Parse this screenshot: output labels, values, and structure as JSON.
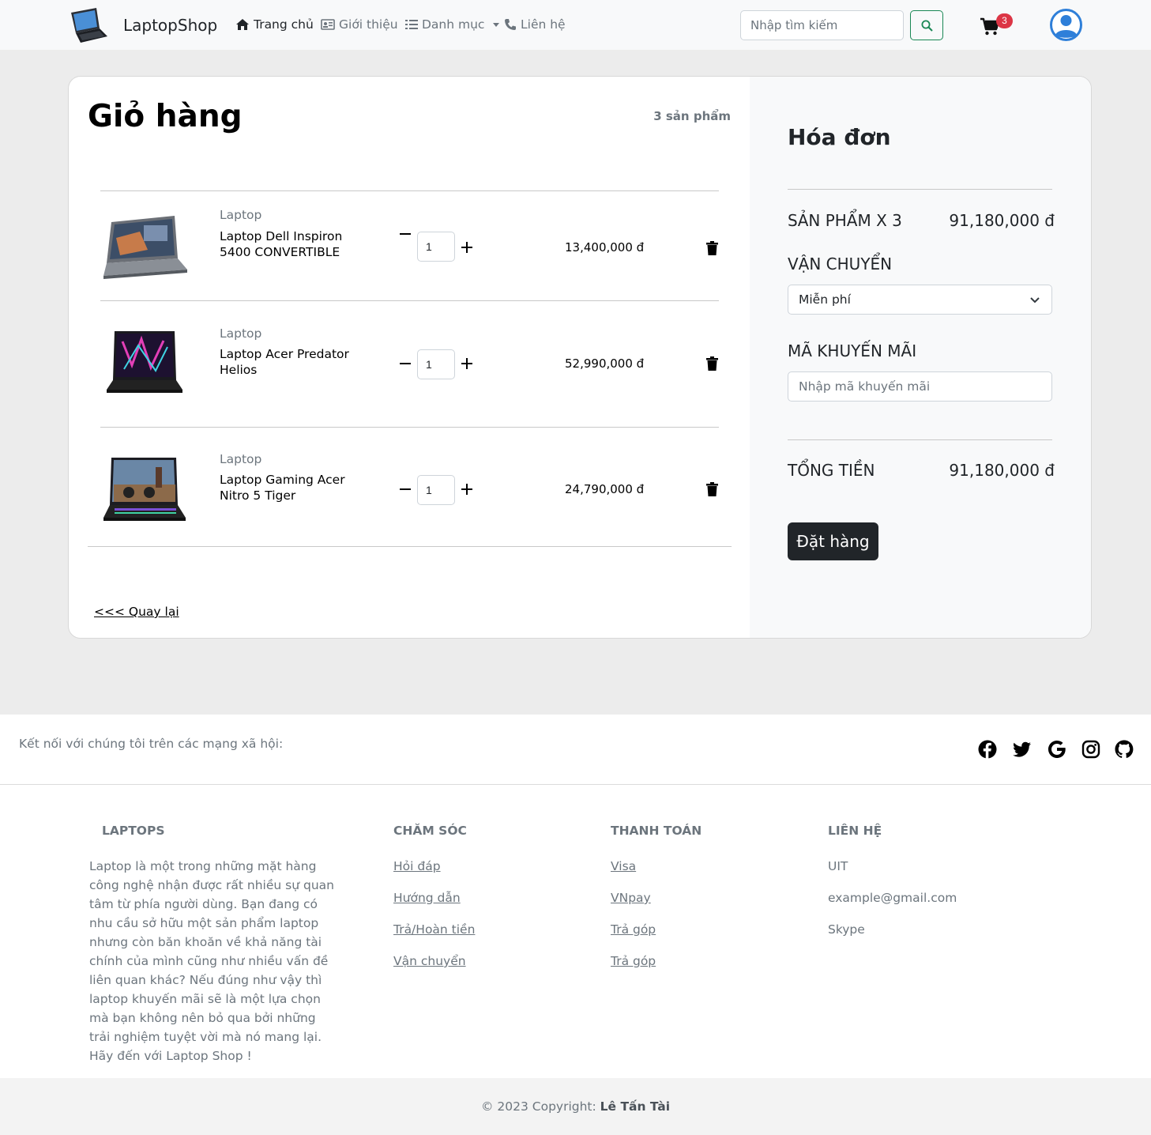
{
  "navbar": {
    "brand": "LaptopShop",
    "items": [
      {
        "label": "Trang chủ",
        "icon": "home-icon",
        "active": true
      },
      {
        "label": "Giới thiệu",
        "icon": "id-card-icon",
        "active": false
      },
      {
        "label": "Danh mục",
        "icon": "list-icon",
        "active": false
      },
      {
        "label": "Liên hệ",
        "icon": "phone-icon",
        "active": false
      }
    ],
    "search_placeholder": "Nhập tìm kiếm",
    "cart_count": "3"
  },
  "cart": {
    "title": "Giỏ hàng",
    "count_label": "3 sản phẩm",
    "items": [
      {
        "category": "Laptop",
        "name": "Laptop Dell Inspiron 5400 CONVERTIBLE",
        "quantity": "1",
        "price": "13,400,000 đ"
      },
      {
        "category": "Laptop",
        "name": "Laptop Acer Predator Helios",
        "quantity": "1",
        "price": "52,990,000 đ"
      },
      {
        "category": "Laptop",
        "name": "Laptop Gaming Acer Nitro 5 Tiger",
        "quantity": "1",
        "price": "24,790,000 đ"
      }
    ],
    "back_label": "<<< Quay lại"
  },
  "summary": {
    "title": "Hóa đơn",
    "products_label": "SẢN PHẨM X 3",
    "products_value": "91,180,000 đ",
    "shipping_label": "VẬN CHUYỂN",
    "shipping_selected": "Miễn phí",
    "promo_label": "MÃ KHUYẾN MÃI",
    "promo_placeholder": "Nhập mã khuyến mãi",
    "total_label": "TỔNG TIỀN",
    "total_value": "91,180,000 đ",
    "order_button": "Đặt hàng"
  },
  "social": {
    "text": "Kết nối với chúng tôi trên các mạng xã hội:",
    "icons": [
      "facebook-icon",
      "twitter-icon",
      "google-icon",
      "instagram-icon",
      "github-icon"
    ]
  },
  "footer": {
    "laptops": {
      "heading": "LAPTOPS",
      "description": "Laptop là một trong những mặt hàng công nghệ nhận được rất nhiều sự quan tâm từ phía người dùng. Bạn đang có nhu cầu sở hữu một sản phẩm laptop nhưng còn băn khoăn về khả năng tài chính của mình cũng như nhiều vấn đề liên quan khác? Nếu đúng như vậy thì laptop khuyến mãi sẽ là một lựa chọn mà bạn không nên bỏ qua bởi những trải nghiệm tuyệt vời mà nó mang lại. Hãy đến với Laptop Shop !"
    },
    "care": {
      "heading": "CHĂM SÓC",
      "links": [
        "Hỏi đáp",
        "Hướng dẫn",
        "Trả/Hoàn tiền",
        "Vận chuyển"
      ]
    },
    "payment": {
      "heading": "THANH TOÁN",
      "links": [
        "Visa",
        "VNpay",
        "Trả góp",
        "Trả góp"
      ]
    },
    "contact": {
      "heading": "LIÊN HỆ",
      "items": [
        "UIT",
        "example@gmail.com",
        "Skype"
      ]
    },
    "copyright_prefix": "© 2023 Copyright:",
    "copyright_name": "Lê Tấn Tài"
  }
}
